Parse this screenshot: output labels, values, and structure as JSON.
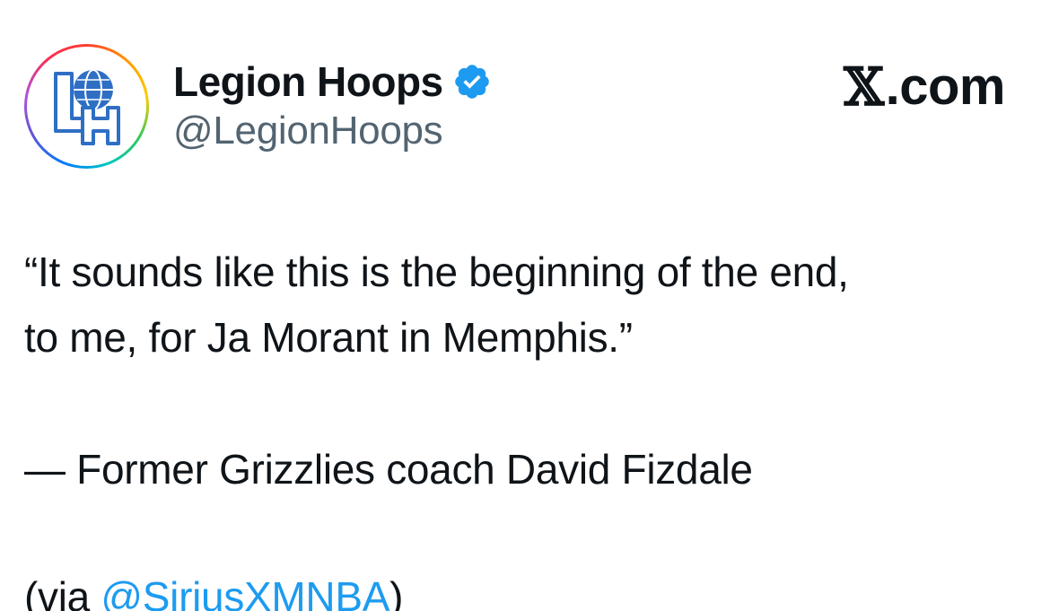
{
  "account": {
    "display_name": "Legion Hoops",
    "handle": "@LegionHoops",
    "verified": true,
    "avatar_monogram": "LH"
  },
  "brand": {
    "x_glyph": "𝕏",
    "domain_suffix": ".com"
  },
  "tweet": {
    "quote_line_1": "“It sounds like this is the beginning of the end,",
    "quote_line_2": "to me, for Ja Morant in Memphis.”",
    "attribution": "— Former Grizzlies coach David Fizdale",
    "via_prefix": "(via ",
    "via_mention": "@SiriusXMNBA",
    "via_suffix": ")"
  },
  "colors": {
    "text": "#0f1419",
    "secondary_text": "#536471",
    "link": "#1d9bf0",
    "verified_badge": "#1d9bf0"
  },
  "icons": {
    "verified": "verified-badge-icon",
    "avatar_logo": "legion-hoops-logo"
  }
}
